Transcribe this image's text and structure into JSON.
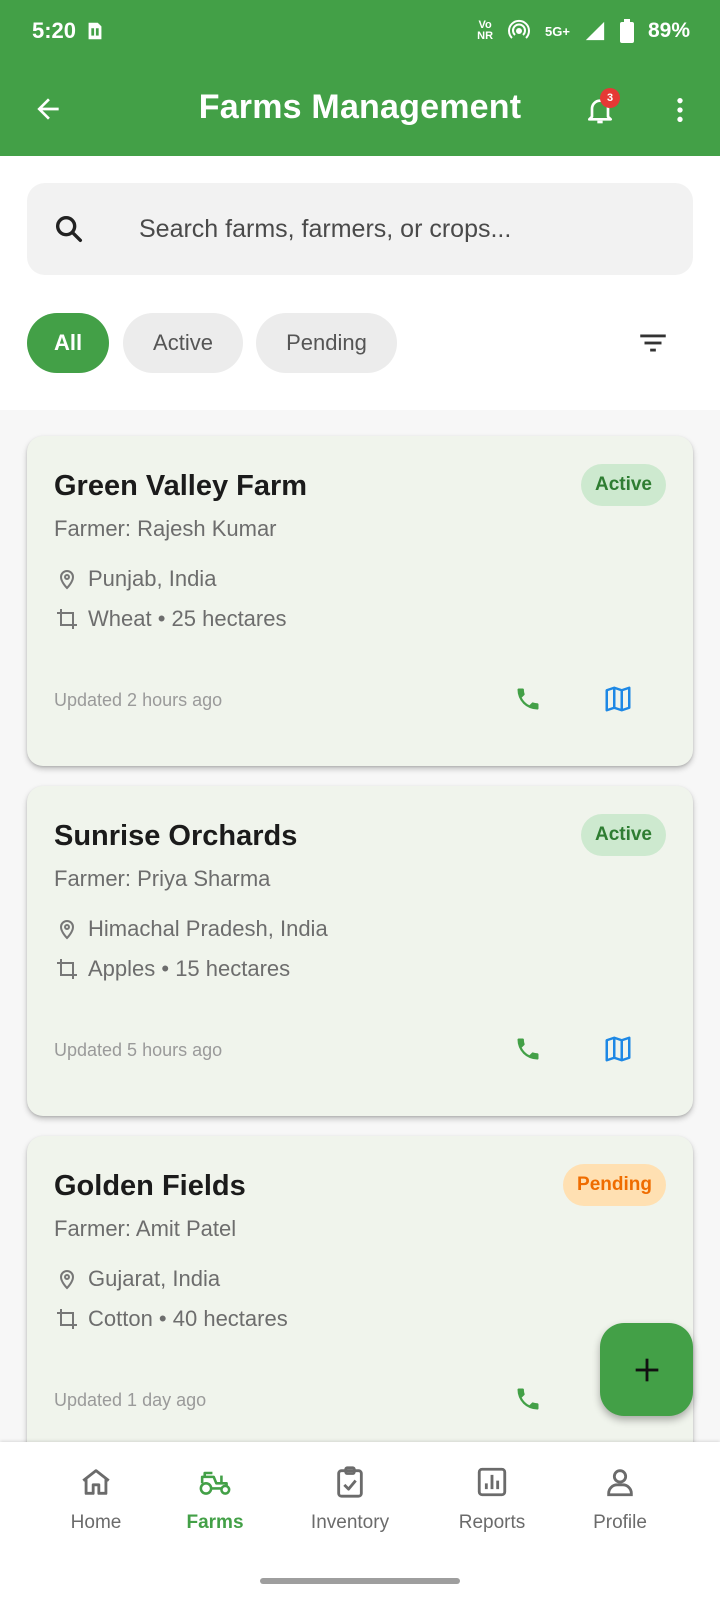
{
  "status_bar": {
    "time": "5:20",
    "volte_top": "Vo",
    "volte_bottom": "NR",
    "network": "5G+",
    "battery": "89%"
  },
  "app_bar": {
    "title": "Farms Management",
    "notification_count": "3",
    "accent_color": "#43a047"
  },
  "search": {
    "placeholder": "Search farms, farmers, or crops...",
    "value": ""
  },
  "filters": {
    "chips": [
      "All",
      "Active",
      "Pending"
    ],
    "selected": "All"
  },
  "farms": [
    {
      "name": "Green Valley Farm",
      "status": "Active",
      "farmer": "Farmer: Rajesh Kumar",
      "location": "Punjab, India",
      "crop": "Wheat • 25 hectares",
      "updated": "Updated 2 hours ago"
    },
    {
      "name": "Sunrise Orchards",
      "status": "Active",
      "farmer": "Farmer: Priya Sharma",
      "location": "Himachal Pradesh, India",
      "crop": "Apples • 15 hectares",
      "updated": "Updated 5 hours ago"
    },
    {
      "name": "Golden Fields",
      "status": "Pending",
      "farmer": "Farmer: Amit Patel",
      "location": "Gujarat, India",
      "crop": "Cotton • 40 hectares",
      "updated": "Updated 1 day ago"
    }
  ],
  "bottom_nav": {
    "items": [
      "Home",
      "Farms",
      "Inventory",
      "Reports",
      "Profile"
    ],
    "selected": "Farms"
  },
  "colors": {
    "active_badge_bg": "#cde9cf",
    "active_badge_text": "#2e7d32",
    "pending_badge_bg": "#ffe0b2",
    "pending_badge_text": "#ef6c00",
    "call_icon": "#43a047",
    "map_icon": "#1e88e5"
  }
}
